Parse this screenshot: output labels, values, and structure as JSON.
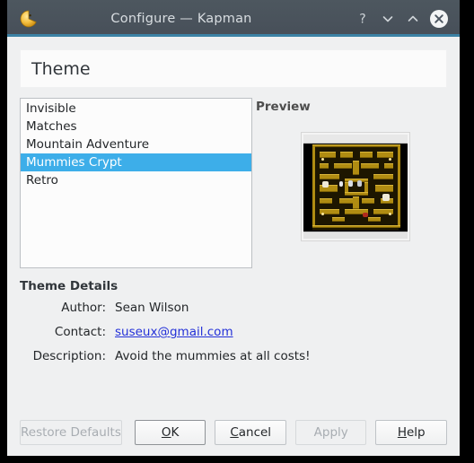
{
  "window": {
    "title": "Configure — Kapman",
    "app_icon": "kapman-pacman-icon",
    "controls": {
      "help": "?",
      "minimize": "chevron-down-icon",
      "maximize": "chevron-up-icon",
      "close": "close-icon"
    },
    "accent_color": "#3c82a5",
    "titlebar_color": "#4b5560"
  },
  "header": {
    "title": "Theme"
  },
  "theme_list": {
    "items": [
      {
        "label": "Invisible",
        "selected": false
      },
      {
        "label": "Matches",
        "selected": false
      },
      {
        "label": "Mountain Adventure",
        "selected": false
      },
      {
        "label": "Mummies Crypt",
        "selected": true
      },
      {
        "label": "Retro",
        "selected": false
      }
    ],
    "selection_color": "#3daee9"
  },
  "preview": {
    "label": "Preview",
    "image_alt": "kapman-maze-preview"
  },
  "details": {
    "title": "Theme Details",
    "rows": [
      {
        "label": "Author:",
        "value": "Sean Wilson",
        "is_link": false
      },
      {
        "label": "Contact:",
        "value": "suseux@gmail.com",
        "is_link": true
      },
      {
        "label": "Description:",
        "value": "Avoid the mummies at all costs!",
        "is_link": false
      }
    ]
  },
  "buttons": {
    "restore_defaults": {
      "label": "Restore Defaults",
      "enabled": false,
      "accel": "R"
    },
    "ok": {
      "label": "OK",
      "enabled": true,
      "accel": "O",
      "default": true
    },
    "cancel": {
      "label": "Cancel",
      "enabled": true,
      "accel": "C"
    },
    "apply": {
      "label": "Apply",
      "enabled": false,
      "accel": "A"
    },
    "help": {
      "label": "Help",
      "enabled": true,
      "accel": "H"
    }
  }
}
